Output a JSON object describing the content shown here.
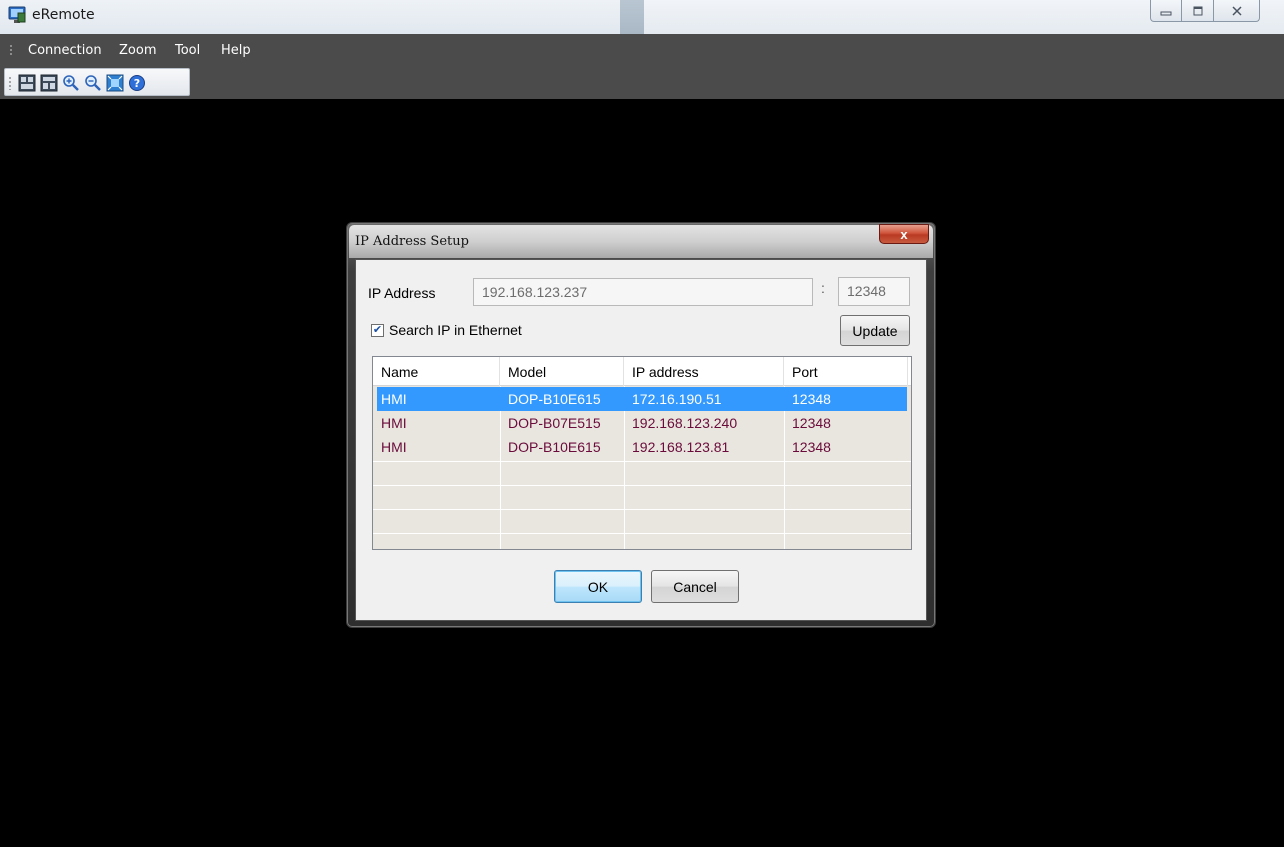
{
  "window": {
    "title": "eRemote",
    "caption_buttons": [
      "minimize",
      "maximize",
      "close"
    ]
  },
  "menu": {
    "items": [
      "Connection",
      "Zoom",
      "Tool",
      "Help"
    ]
  },
  "toolbar": {
    "buttons": [
      "window-layout-icon",
      "window-layout-alt-icon",
      "zoom-in-icon",
      "zoom-out-icon",
      "fit-screen-icon",
      "help-icon"
    ]
  },
  "dialog": {
    "title": "IP Address Setup",
    "close_label": "x",
    "ip_label": "IP Address",
    "ip_value": "192.168.123.237",
    "port_separator": ":",
    "port_value": "12348",
    "search_label": "Search IP in Ethernet",
    "search_checked": true,
    "update_label": "Update",
    "ok_label": "OK",
    "cancel_label": "Cancel",
    "table": {
      "columns": [
        "Name",
        "Model",
        "IP address",
        "Port"
      ],
      "rows": [
        {
          "name": "HMI",
          "model": "DOP-B10E615",
          "ip": "172.16.190.51",
          "port": "12348",
          "selected": true
        },
        {
          "name": "HMI",
          "model": "DOP-B07E515",
          "ip": "192.168.123.240",
          "port": "12348",
          "selected": false
        },
        {
          "name": "HMI",
          "model": "DOP-B10E615",
          "ip": "192.168.123.81",
          "port": "12348",
          "selected": false
        }
      ]
    }
  },
  "colors": {
    "selection": "#3399ff",
    "row_text": "#6b0b3b",
    "menubar": "#4b4b4b",
    "close_button": "#c75a3f"
  }
}
